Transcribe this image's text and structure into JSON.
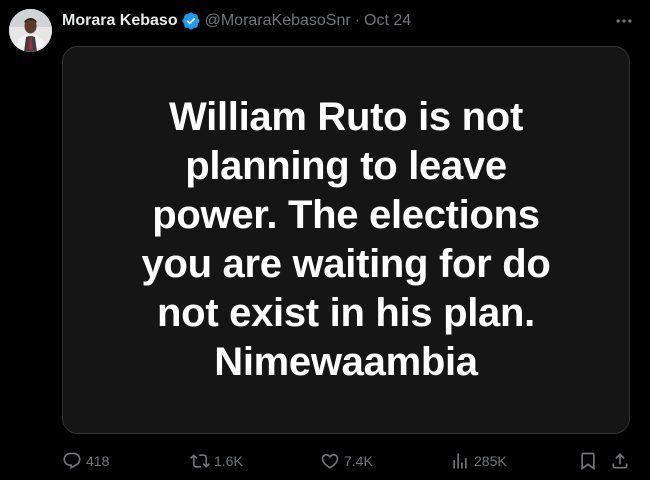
{
  "tweet": {
    "author_name": "Morara Kebaso",
    "handle": "@MoraraKebasoSnr",
    "separator": "·",
    "date": "Oct 24",
    "media_text": "William Ruto is not\nplanning to leave\npower. The elections\nyou are waiting for do\nnot exist in his plan.\nNimewaambia"
  },
  "actions": {
    "replies": "418",
    "reposts": "1.6K",
    "likes": "7.4K",
    "views": "285K"
  },
  "icons": {
    "verified": "verified-badge-icon",
    "more": "more-icon",
    "reply": "reply-icon",
    "repost": "repost-icon",
    "like": "heart-icon",
    "views": "views-icon",
    "bookmark": "bookmark-icon",
    "share": "share-icon"
  },
  "colors": {
    "background": "#000000",
    "media_background": "#151515",
    "text_primary": "#e7e9ea",
    "text_secondary": "#71767b",
    "verified_blue": "#1d9bf0"
  }
}
